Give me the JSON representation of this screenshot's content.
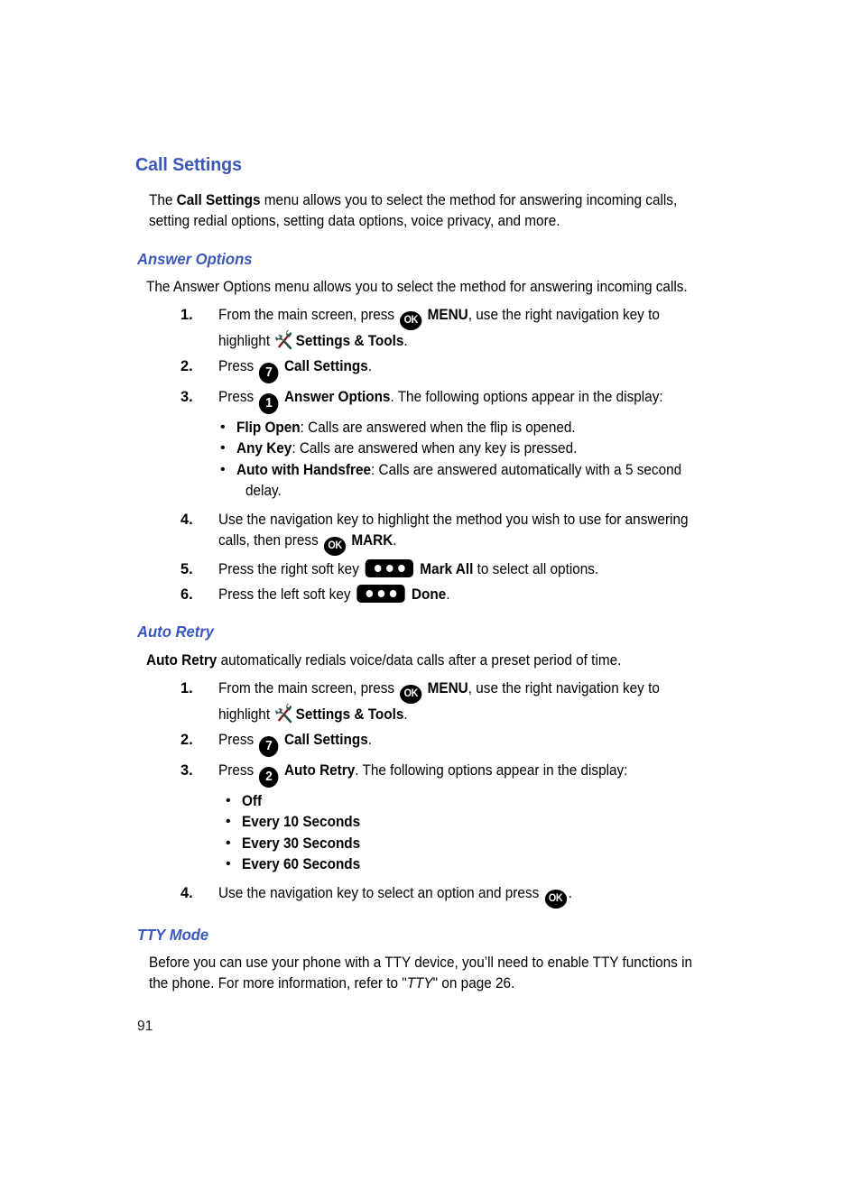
{
  "page": {
    "number": "91"
  },
  "section": {
    "title": "Call Settings",
    "intro_pre": "The ",
    "intro_bold": "Call Settings",
    "intro_post": " menu allows you to select the method for answering incoming calls, setting redial options, setting data options, voice privacy, and more."
  },
  "answer_options": {
    "heading": "Answer Options",
    "intro": "The Answer Options menu allows you to select the method for answering incoming calls.",
    "steps": [
      {
        "num": "1.",
        "t1": "From the main screen, press ",
        "icon1": "ok-key-icon",
        "t2": " ",
        "b1": "MENU",
        "t3": ", use the right navigation key to highlight ",
        "icon2": "settings-tools-icon",
        "b2": "Settings & Tools",
        "t4": "."
      },
      {
        "num": "2.",
        "t1": "Press ",
        "icon1": "number-key-7-icon",
        "key": "7",
        "b1": "Call Settings",
        "t2": "."
      },
      {
        "num": "3.",
        "t1": "Press ",
        "icon1": "number-key-1-icon",
        "key": "1",
        "b1": "Answer Options",
        "t2": ". The following options appear in the display:"
      },
      {
        "num": "4.",
        "t1": "Use the navigation key to highlight the method you wish to use for answering calls, then press ",
        "icon1": "ok-key-icon",
        "t2": " ",
        "b1": "MARK",
        "t3": "."
      },
      {
        "num": "5.",
        "t1": "Press the right soft key ",
        "icon1": "soft-key-icon",
        "t2": " ",
        "b1": "Mark All",
        "t3": " to select all options."
      },
      {
        "num": "6.",
        "t1": "Press the left soft key ",
        "icon1": "soft-key-icon",
        "t2": " ",
        "b1": "Done",
        "t3": "."
      }
    ],
    "bullets": [
      {
        "label": "Flip Open",
        "desc": ": Calls are answered when the flip is opened."
      },
      {
        "label": "Any Key",
        "desc": ": Calls are answered when any key is pressed."
      },
      {
        "label": "Auto with Handsfree",
        "desc": ": Calls are answered automatically with a 5 second",
        "cont": "delay."
      }
    ]
  },
  "auto_retry": {
    "heading": "Auto Retry",
    "intro_bold": "Auto Retry",
    "intro_post": " automatically redials voice/data calls after a preset period of time.",
    "steps": [
      {
        "num": "1.",
        "t1": "From the main screen, press ",
        "icon1": "ok-key-icon",
        "t2": " ",
        "b1": "MENU",
        "t3": ", use the right navigation key to highlight ",
        "icon2": "settings-tools-icon",
        "b2": "Settings & Tools",
        "t4": "."
      },
      {
        "num": "2.",
        "t1": "Press ",
        "icon1": "number-key-7-icon",
        "key": "7",
        "b1": "Call Settings",
        "t2": "."
      },
      {
        "num": "3.",
        "t1": "Press ",
        "icon1": "number-key-2-icon",
        "key": "2",
        "b1": "Auto Retry",
        "t2": ". The following options appear in the display:"
      },
      {
        "num": "4.",
        "t1": "Use the navigation key to select an option and press ",
        "icon1": "ok-key-icon",
        "t2": "."
      }
    ],
    "bullets": [
      {
        "label": "Off"
      },
      {
        "label": "Every 10 Seconds"
      },
      {
        "label": "Every 30 Seconds"
      },
      {
        "label": "Every 60 Seconds"
      }
    ]
  },
  "tty_mode": {
    "heading": "TTY Mode",
    "p1": "Before you can use your phone with a TTY device, you’ll need to enable TTY functions in the phone. For more information, refer to ",
    "ref_open": "\"",
    "ref": "TTY",
    "ref_close": "\"",
    "p2": " on page 26."
  },
  "colors": {
    "heading_blue": "#3a57ba",
    "text_black": "#000000",
    "icon_black": "#000000",
    "tools_wrench": "#2f4f45",
    "tools_handle": "#8d1420"
  },
  "icons": {
    "ok_label": "OK",
    "soft_key_dots": 3
  }
}
